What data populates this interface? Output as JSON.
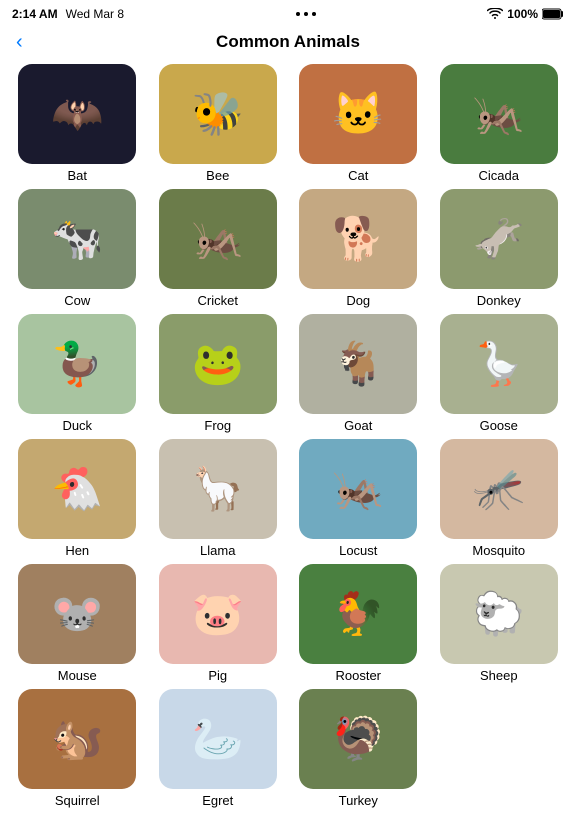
{
  "statusBar": {
    "time": "2:14 AM",
    "day": "Wed Mar 8",
    "dots": [
      "•",
      "•",
      "•"
    ],
    "wifi": "WiFi",
    "battery": "100%"
  },
  "nav": {
    "backLabel": "‹",
    "title": "Common Animals"
  },
  "animals": [
    {
      "id": "bat",
      "label": "Bat",
      "bg": "bg-bat",
      "emoji": "🦇"
    },
    {
      "id": "bee",
      "label": "Bee",
      "bg": "bg-bee",
      "emoji": "🐝"
    },
    {
      "id": "cat",
      "label": "Cat",
      "bg": "bg-cat",
      "emoji": "🐱"
    },
    {
      "id": "cicada",
      "label": "Cicada",
      "bg": "bg-cicada",
      "emoji": "🦗"
    },
    {
      "id": "cow",
      "label": "Cow",
      "bg": "bg-cow",
      "emoji": "🐄"
    },
    {
      "id": "cricket",
      "label": "Cricket",
      "bg": "bg-cricket",
      "emoji": "🦗"
    },
    {
      "id": "dog",
      "label": "Dog",
      "bg": "bg-dog",
      "emoji": "🐕"
    },
    {
      "id": "donkey",
      "label": "Donkey",
      "bg": "bg-donkey",
      "emoji": "🫏"
    },
    {
      "id": "duck",
      "label": "Duck",
      "bg": "bg-duck",
      "emoji": "🦆"
    },
    {
      "id": "frog",
      "label": "Frog",
      "bg": "bg-frog",
      "emoji": "🐸"
    },
    {
      "id": "goat",
      "label": "Goat",
      "bg": "bg-goat",
      "emoji": "🐐"
    },
    {
      "id": "goose",
      "label": "Goose",
      "bg": "bg-goose",
      "emoji": "🪿"
    },
    {
      "id": "hen",
      "label": "Hen",
      "bg": "bg-hen",
      "emoji": "🐔"
    },
    {
      "id": "llama",
      "label": "Llama",
      "bg": "bg-llama",
      "emoji": "🦙"
    },
    {
      "id": "locust",
      "label": "Locust",
      "bg": "bg-locust",
      "emoji": "🦗"
    },
    {
      "id": "mosquito",
      "label": "Mosquito",
      "bg": "bg-mosquito",
      "emoji": "🦟"
    },
    {
      "id": "mouse",
      "label": "Mouse",
      "bg": "bg-mouse",
      "emoji": "🐭"
    },
    {
      "id": "pig",
      "label": "Pig",
      "bg": "bg-pig",
      "emoji": "🐷"
    },
    {
      "id": "rooster",
      "label": "Rooster",
      "bg": "bg-rooster",
      "emoji": "🐓"
    },
    {
      "id": "sheep",
      "label": "Sheep",
      "bg": "bg-sheep",
      "emoji": "🐑"
    },
    {
      "id": "squirrel",
      "label": "Squirrel",
      "bg": "bg-squirrel",
      "emoji": "🐿️"
    },
    {
      "id": "egret",
      "label": "Egret",
      "bg": "bg-egret",
      "emoji": "🦢"
    },
    {
      "id": "turkey",
      "label": "Turkey",
      "bg": "bg-turkey",
      "emoji": "🦃"
    }
  ]
}
